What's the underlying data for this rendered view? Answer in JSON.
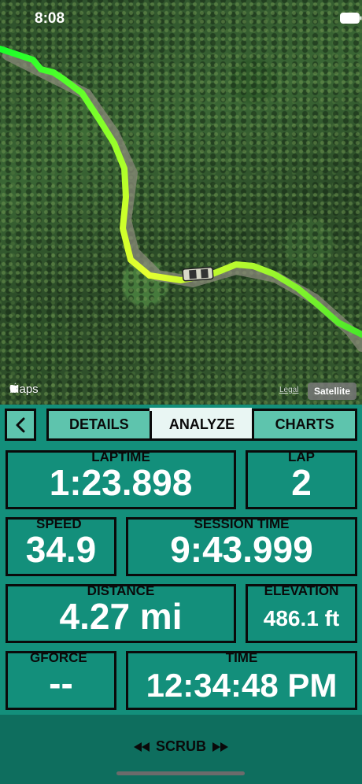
{
  "status": {
    "time": "8:08"
  },
  "map": {
    "attribution": "Maps",
    "legal": "Legal",
    "satellite_label": "Satellite"
  },
  "tabs": [
    {
      "label": "DETAILS",
      "active": false
    },
    {
      "label": "ANALYZE",
      "active": true
    },
    {
      "label": "CHARTS",
      "active": false
    }
  ],
  "metrics": {
    "laptime": {
      "label": "LAPTIME",
      "value": "1:23.898"
    },
    "lap": {
      "label": "LAP",
      "value": "2"
    },
    "speed": {
      "label": "SPEED",
      "value": "34.9"
    },
    "session_time": {
      "label": "SESSION TIME",
      "value": "9:43.999"
    },
    "distance": {
      "label": "DISTANCE",
      "value": "4.27 mi"
    },
    "elevation": {
      "label": "ELEVATION",
      "value": "486.1 ft"
    },
    "gforce": {
      "label": "GFORCE",
      "value": "--"
    },
    "time": {
      "label": "TIME",
      "value": "12:34:48 PM"
    }
  },
  "scrub": {
    "label": "SCRUB"
  },
  "icons": {
    "back": "chevron-left-icon",
    "rewind": "rewind-icon",
    "fast_forward": "fast-forward-icon",
    "wifi": "wifi-icon",
    "battery": "battery-icon",
    "apple": "apple-logo-icon",
    "car": "car-icon"
  },
  "colors": {
    "panel": "#138f7b",
    "tab_fill": "#5ec4ad",
    "tab_active": "#e9f6f3",
    "route_start": "#00ff3c",
    "route_slow": "#f0ff30"
  }
}
